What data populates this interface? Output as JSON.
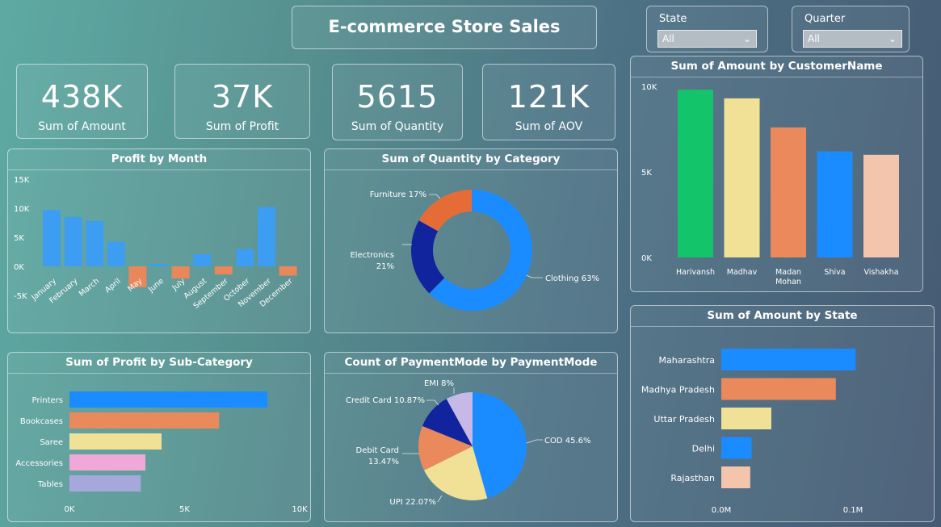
{
  "title": "E-commerce Store Sales",
  "slicers": [
    {
      "label": "State",
      "value": "All"
    },
    {
      "label": "Quarter",
      "value": "All"
    }
  ],
  "kpis": [
    {
      "value": "438K",
      "label": "Sum of Amount"
    },
    {
      "value": "37K",
      "label": "Sum of Profit"
    },
    {
      "value": "5615",
      "label": "Sum of Quantity"
    },
    {
      "value": "121K",
      "label": "Sum of AOV"
    }
  ],
  "colors": {
    "blue": "#3d9df2",
    "orange": "#e8875a",
    "bar_blue": "#1a8cff",
    "navy": "#12239e",
    "dark_orange": "#e66c37",
    "green": "#14c46a",
    "yellow": "#f0e197",
    "salmon": "#ea8a5c",
    "peach": "#f2c5ac",
    "pink": "#f0a8d8",
    "lavender": "#a6a8dc",
    "light_purple": "#c6b9e6"
  },
  "chart_data": [
    {
      "id": "profit_by_month",
      "type": "bar",
      "title": "Profit by Month",
      "categories": [
        "January",
        "February",
        "March",
        "April",
        "May",
        "June",
        "July",
        "August",
        "September",
        "October",
        "November",
        "December"
      ],
      "values": [
        9700,
        8500,
        7800,
        4200,
        -3600,
        400,
        -2100,
        2100,
        -1400,
        3000,
        10200,
        -1600
      ],
      "yticks": [
        "15K",
        "10K",
        "5K",
        "0K",
        "-5K"
      ],
      "ylim": [
        -5000,
        15000
      ]
    },
    {
      "id": "quantity_by_category",
      "type": "pie",
      "title": "Sum of Quantity by Category",
      "labels": [
        "Clothing",
        "Electronics",
        "Furniture"
      ],
      "values": [
        63,
        21,
        17
      ],
      "display": [
        "Clothing 63%",
        "Electronics",
        "21%",
        "Furniture 17%"
      ],
      "donut": true
    },
    {
      "id": "amount_by_customer",
      "type": "bar",
      "title": "Sum of Amount by CustomerName",
      "categories": [
        "Harivansh",
        "Madhav",
        "Madan Mohan",
        "Shiva",
        "Vishakha"
      ],
      "category_lines": [
        [
          "Harivansh"
        ],
        [
          "Madhav"
        ],
        [
          "Madan",
          "Mohan"
        ],
        [
          "Shiva"
        ],
        [
          "Vishakha"
        ]
      ],
      "values": [
        9800,
        9300,
        7600,
        6200,
        6000
      ],
      "yticks": [
        "10K",
        "5K",
        "0K"
      ],
      "ylim": [
        0,
        10000
      ]
    },
    {
      "id": "profit_by_subcategory",
      "type": "bar",
      "orientation": "horizontal",
      "title": "Sum of Profit by Sub-Category",
      "categories": [
        "Printers",
        "Bookcases",
        "Saree",
        "Accessories",
        "Tables"
      ],
      "values": [
        8600,
        6500,
        4000,
        3300,
        3100
      ],
      "xticks": [
        "0K",
        "5K",
        "10K"
      ],
      "xlim": [
        0,
        10000
      ]
    },
    {
      "id": "paymentmode_count",
      "type": "pie",
      "title": "Count of PaymentMode by PaymentMode",
      "labels": [
        "COD",
        "UPI",
        "Debit Card",
        "Credit Card",
        "EMI"
      ],
      "values": [
        45.6,
        22.07,
        13.47,
        10.87,
        8
      ],
      "display": [
        "COD 45.6%",
        "UPI 22.07%",
        "Debit Card",
        "13.47%",
        "Credit Card 10.87%",
        "EMI 8%"
      ]
    },
    {
      "id": "amount_by_state",
      "type": "bar",
      "orientation": "horizontal",
      "title": "Sum of Amount by State",
      "categories": [
        "Maharashtra",
        "Madhya Pradesh",
        "Uttar Pradesh",
        "Delhi",
        "Rajasthan"
      ],
      "values": [
        102000,
        87000,
        38000,
        23000,
        22000
      ],
      "xticks": [
        "0.0M",
        "0.1M"
      ],
      "xlim": [
        0,
        100000
      ]
    }
  ]
}
